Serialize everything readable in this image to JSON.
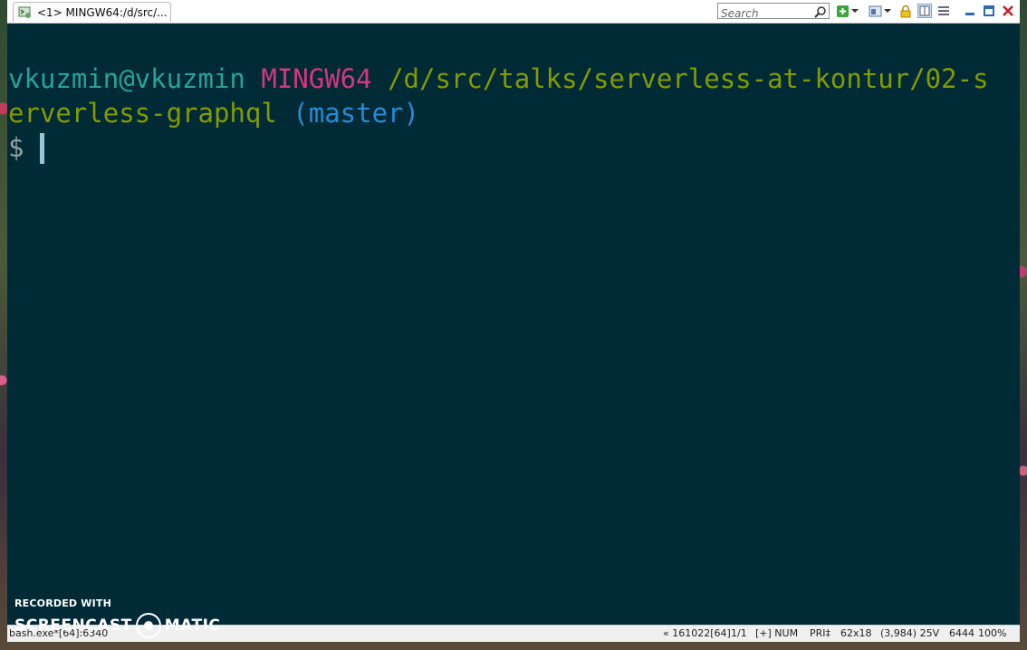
{
  "window": {
    "tab_title": "<1> MINGW64:/d/src/...",
    "search_placeholder": "Search"
  },
  "terminal": {
    "user_host": "vkuzmin@vkuzmin",
    "system": "MINGW64",
    "path_part1": "/d/src/talks/serverless-at-kontur/02-s",
    "path_part2": "erverless-graphql",
    "branch": "(master)",
    "prompt_symbol": "$"
  },
  "statusbar": {
    "process": "bash.exe*[64]:6340",
    "build": "« 161022[64]",
    "pages": "1/1",
    "mode": "[+] NUM",
    "priority": "PRI‡",
    "size": "62x18",
    "cursor_pos": "(3,984) 25V",
    "pid": "6444",
    "zoom": "100%"
  },
  "watermark": {
    "line1": "RECORDED WITH",
    "brand_left": "SCREENCAST",
    "brand_right": "MATIC"
  },
  "colors": {
    "terminal_bg": "#002b36",
    "user_host": "#2aa198",
    "system": "#d33682",
    "path": "#859900",
    "branch": "#268bd2"
  },
  "icons": [
    "app-icon",
    "search-icon",
    "new-console-icon",
    "dropdown-icon",
    "view-icon",
    "lock-icon",
    "split-icon",
    "menu-icon",
    "minimize-icon",
    "maximize-icon",
    "close-icon"
  ]
}
